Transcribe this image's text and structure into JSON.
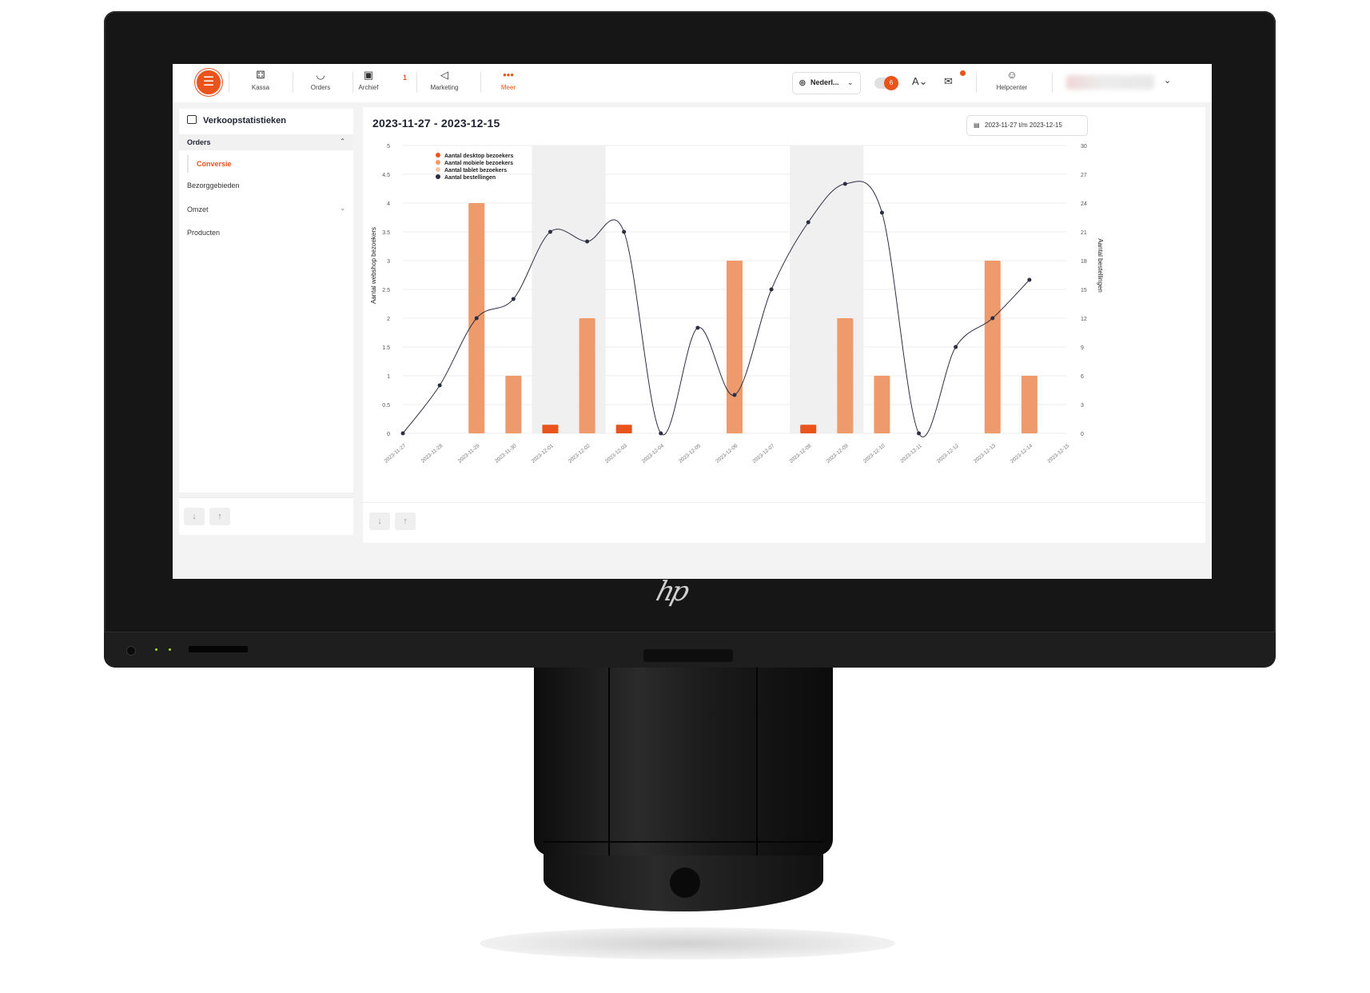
{
  "nav": {
    "items": [
      {
        "label": "Kassa",
        "icon": "register-icon"
      },
      {
        "label": "Orders",
        "icon": "bowl-icon"
      },
      {
        "label": "Archief",
        "icon": "archive-icon",
        "badge": "1"
      },
      {
        "label": "Marketing",
        "icon": "megaphone-icon"
      },
      {
        "label": "Meer",
        "icon": "more-dots-icon"
      }
    ],
    "language": "Nederl...",
    "toggle_badge": "6",
    "helpcenter": "Helpcenter"
  },
  "sidebar": {
    "title": "Verkoopstatistieken",
    "section": "Orders",
    "sub_item": "Conversie",
    "items": [
      "Bezorggebieden",
      "Omzet",
      "Producten"
    ]
  },
  "main": {
    "title": "2023-11-27 - 2023-12-15",
    "range_label": "2023-11-27 t/m 2023-12-15"
  },
  "colors": {
    "accent": "#e8541c",
    "bar_mobile": "#ef9a6c",
    "bar_desktop": "#e8541c",
    "line": "#2b2d42"
  },
  "chart_data": {
    "type": "bar",
    "x": [
      "2023-11-27",
      "2023-11-28",
      "2023-11-29",
      "2023-11-30",
      "2023-12-01",
      "2023-12-02",
      "2023-12-03",
      "2023-12-04",
      "2023-12-05",
      "2023-12-06",
      "2023-12-07",
      "2023-12-08",
      "2023-12-09",
      "2023-12-10",
      "2023-12-11",
      "2023-12-12",
      "2023-12-13",
      "2023-12-14",
      "2023-12-15"
    ],
    "ylabel": "Aantal webshop bezoekers",
    "y2label": "Aantal bestellingen",
    "ylim": [
      0,
      5
    ],
    "y2lim": [
      0,
      30
    ],
    "yticks": [
      "0",
      "0.5",
      "1",
      "1.5",
      "2",
      "2.5",
      "3",
      "3.5",
      "4",
      "4.5",
      "5"
    ],
    "y2ticks": [
      "0",
      "3",
      "6",
      "9",
      "12",
      "15",
      "18",
      "21",
      "24",
      "27",
      "30"
    ],
    "legend": "top-left",
    "weekend_shading": [
      [
        4,
        5
      ],
      [
        11,
        12
      ]
    ],
    "series": [
      {
        "name": "Aantal desktop bezoekers",
        "type": "bar",
        "values": [
          0,
          0,
          0,
          0,
          0.15,
          0,
          0.15,
          0,
          0,
          0,
          0,
          0.15,
          0,
          0,
          0,
          0,
          0,
          0,
          0
        ]
      },
      {
        "name": "Aantal mobiele bezoekers",
        "type": "bar",
        "values": [
          0,
          0,
          4,
          1,
          0,
          2,
          0,
          0,
          0,
          3,
          0,
          0,
          2,
          1,
          0,
          0,
          3,
          1,
          0
        ]
      },
      {
        "name": "Aantal tablet bezoekers",
        "type": "bar",
        "values": [
          0,
          0,
          0,
          0,
          0,
          0,
          0,
          0,
          0,
          0,
          0,
          0,
          0,
          0,
          0,
          0,
          0,
          0,
          0
        ]
      },
      {
        "name": "Aantal bestellingen",
        "type": "line",
        "axis": "right",
        "values": [
          0,
          5,
          12,
          14,
          21,
          20,
          21,
          0,
          11,
          4,
          15,
          22,
          26,
          23,
          0,
          9,
          12,
          16
        ]
      }
    ]
  }
}
